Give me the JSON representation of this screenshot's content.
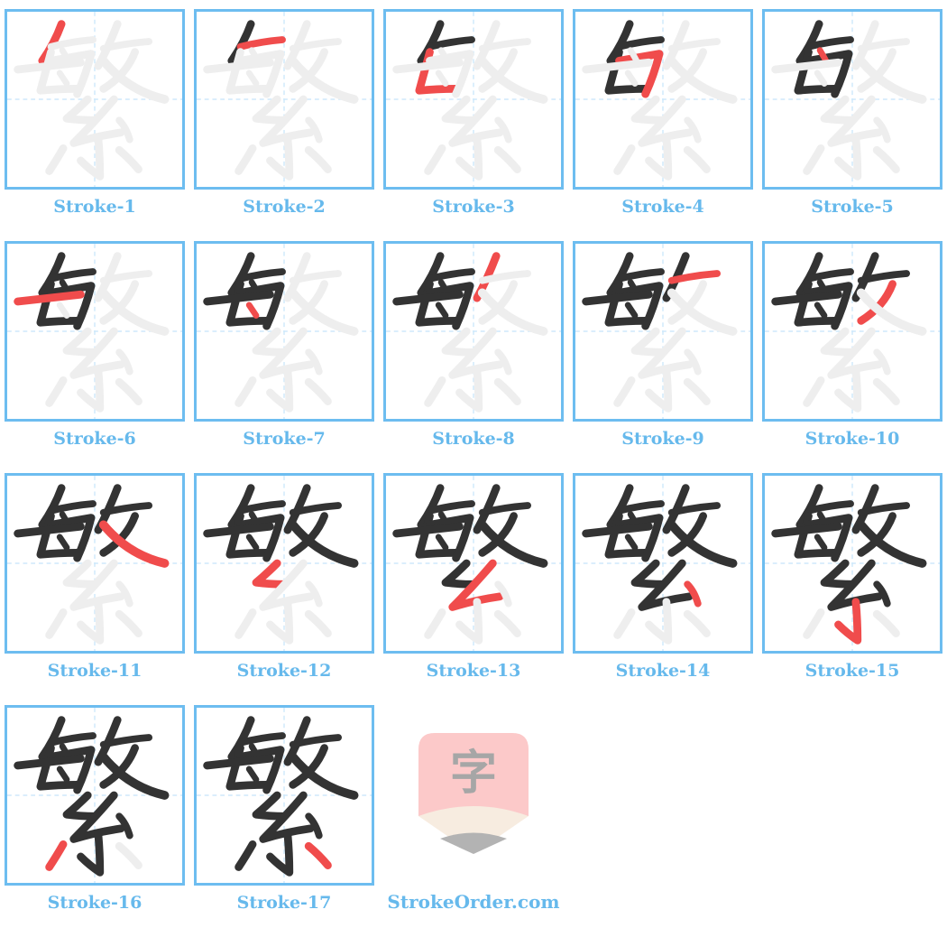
{
  "character": "繁",
  "colors": {
    "border": "#6dbdf0",
    "label": "#66b9ec",
    "guide": "#cfe9fb",
    "pending_stroke": "#eeeeee",
    "done_stroke": "#333333",
    "current_stroke": "#f04c4c"
  },
  "cells": [
    {
      "label": "Stroke-1",
      "stroke": 1
    },
    {
      "label": "Stroke-2",
      "stroke": 2
    },
    {
      "label": "Stroke-3",
      "stroke": 3
    },
    {
      "label": "Stroke-4",
      "stroke": 4
    },
    {
      "label": "Stroke-5",
      "stroke": 5
    },
    {
      "label": "Stroke-6",
      "stroke": 6
    },
    {
      "label": "Stroke-7",
      "stroke": 7
    },
    {
      "label": "Stroke-8",
      "stroke": 8
    },
    {
      "label": "Stroke-9",
      "stroke": 9
    },
    {
      "label": "Stroke-10",
      "stroke": 10
    },
    {
      "label": "Stroke-11",
      "stroke": 11
    },
    {
      "label": "Stroke-12",
      "stroke": 12
    },
    {
      "label": "Stroke-13",
      "stroke": 13
    },
    {
      "label": "Stroke-14",
      "stroke": 14
    },
    {
      "label": "Stroke-15",
      "stroke": 15
    },
    {
      "label": "Stroke-16",
      "stroke": 16
    },
    {
      "label": "Stroke-17",
      "stroke": 17
    }
  ],
  "total_strokes": 17,
  "logo": {
    "glyph": "字",
    "icon": "pencil-logo-icon",
    "colors": {
      "body": "#fcc9c9",
      "glyph": "#a6a6a6",
      "wood": "#f7ece0",
      "tip": "#b3b3b3"
    }
  },
  "site_name": "StrokeOrder.com"
}
